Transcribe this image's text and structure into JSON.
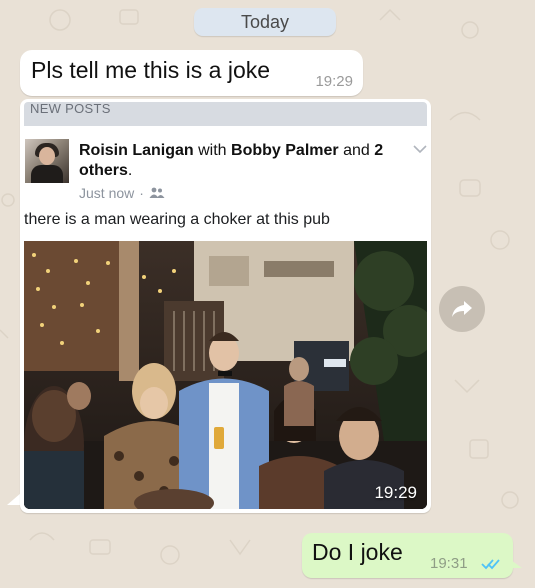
{
  "date_divider": "Today",
  "incoming_message": {
    "text": "Pls tell me this is a joke",
    "time": "19:29"
  },
  "shared_post": {
    "banner": "NEW POSTS",
    "author": "Roisin Lanigan",
    "with_word": "with",
    "tagged": "Bobby Palmer",
    "and_word": "and",
    "others": "2 others",
    "period": ".",
    "timestamp": "Just now",
    "separator": "·",
    "privacy_icon": "friends-icon",
    "text": "there is a man wearing a choker at this pub",
    "photo_time": "19:29"
  },
  "forward_icon": "share-arrow-icon",
  "outgoing_message": {
    "text": "Do I joke",
    "time": "19:31",
    "status_icon": "double-check-icon"
  },
  "colors": {
    "wallpaper": "#e9e1d6",
    "incoming_bubble": "#ffffff",
    "outgoing_bubble": "#dcf8c6",
    "read_ticks": "#4fc3f7",
    "date_pill": "#dde6f0"
  }
}
